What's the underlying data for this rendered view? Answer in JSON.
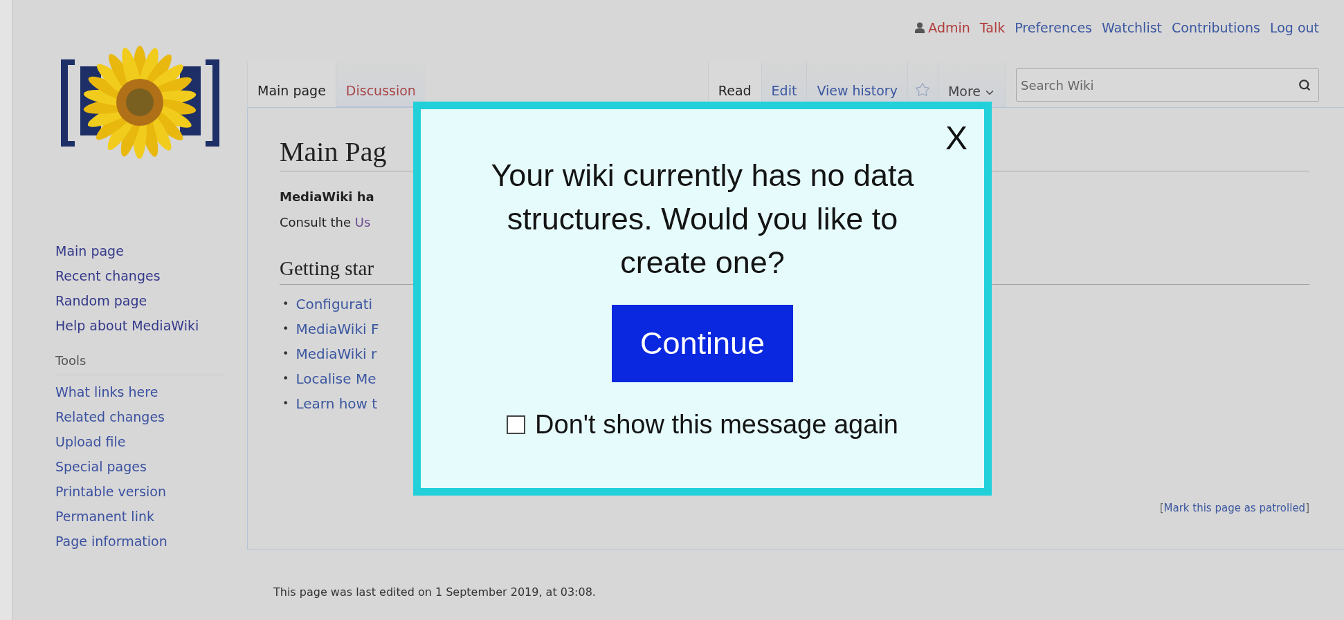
{
  "personal_links": [
    {
      "label": "Admin",
      "color": "#b03a3a",
      "kind": "user"
    },
    {
      "label": "Talk",
      "color": "#b03a3a",
      "kind": "link"
    },
    {
      "label": "Preferences",
      "color": "#3a56a0",
      "kind": "link"
    },
    {
      "label": "Watchlist",
      "color": "#3a56a0",
      "kind": "link"
    },
    {
      "label": "Contributions",
      "color": "#3a56a0",
      "kind": "link"
    },
    {
      "label": "Log out",
      "color": "#3a56a0",
      "kind": "link"
    }
  ],
  "page_tabs": [
    {
      "label": "Main page",
      "selected": true
    },
    {
      "label": "Discussion",
      "selected": false,
      "color": "#a8464a"
    }
  ],
  "view_tabs": [
    {
      "label": "Read",
      "selected": true
    },
    {
      "label": "Edit",
      "selected": false
    },
    {
      "label": "View history",
      "selected": false
    }
  ],
  "watch": {
    "watched": false
  },
  "more_menu": {
    "label": "More"
  },
  "search": {
    "placeholder": "Search Wiki"
  },
  "sidebar": {
    "navigation": [
      "Main page",
      "Recent changes",
      "Random page",
      "Help about MediaWiki"
    ],
    "tools": {
      "heading": "Tools",
      "items": [
        "What links here",
        "Related changes",
        "Upload file",
        "Special pages",
        "Printable version",
        "Permanent link",
        "Page information"
      ]
    }
  },
  "content": {
    "title": "Main Pag",
    "intro": "MediaWiki ha",
    "consult": {
      "text": "Consult the",
      "link": "Us"
    },
    "heading": "Getting star",
    "bullets": [
      {
        "marker": "•",
        "text": "Configurati"
      },
      {
        "marker": "•",
        "text": "MediaWiki F"
      },
      {
        "marker": "•",
        "text": "MediaWiki r"
      },
      {
        "marker": "•",
        "text": "Localise Me"
      },
      {
        "marker": "•",
        "text": "Learn how t"
      }
    ],
    "patrol": {
      "open": "[",
      "link": "Mark this page as patrolled",
      "close": "]"
    }
  },
  "footer": "This page was last edited on 1 September 2019, at 03:08.",
  "modal": {
    "close": "X",
    "message": "Your wiki currently has no data structures. Would you like to create one?",
    "button": "Continue",
    "checkbox": {
      "label": "Don't show this message again",
      "checked": false
    }
  }
}
